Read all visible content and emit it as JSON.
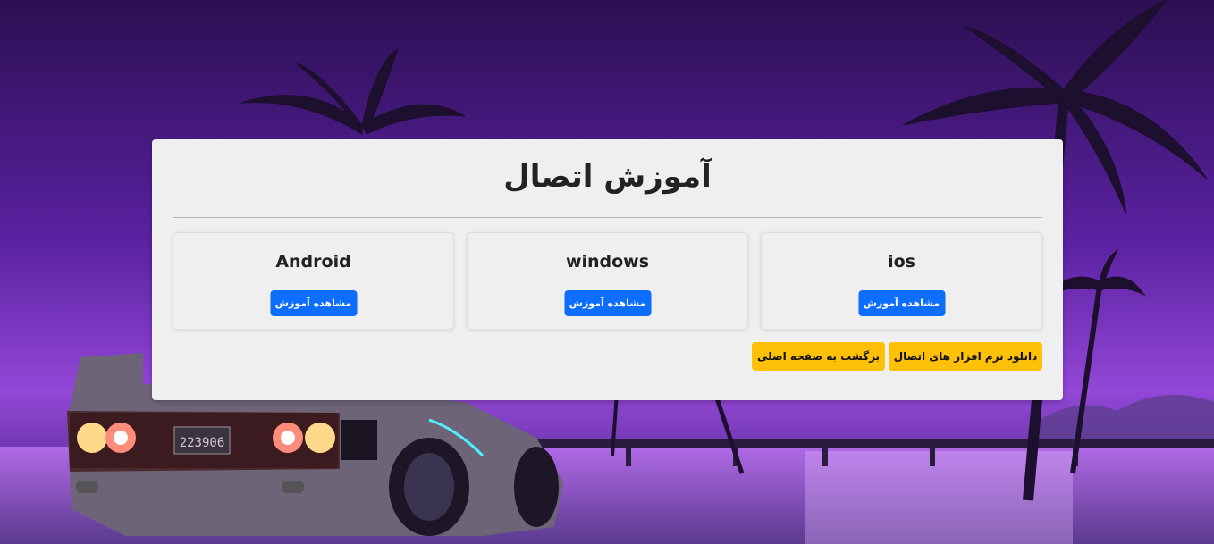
{
  "page": {
    "title": "آموزش اتصال"
  },
  "platforms": [
    {
      "name": "ios",
      "button_label": "مشاهده آموزش"
    },
    {
      "name": "windows",
      "button_label": "مشاهده آموزش"
    },
    {
      "name": "Android",
      "button_label": "مشاهده آموزش"
    }
  ],
  "actions": {
    "download_label": "دانلود نرم افزار های اتصال",
    "back_label": "برگشت به صفحه اصلی"
  },
  "background": {
    "plate_text": "223906"
  },
  "colors": {
    "primary": "#0d6efd",
    "warning": "#ffc107",
    "card_bg": "#efefef"
  }
}
